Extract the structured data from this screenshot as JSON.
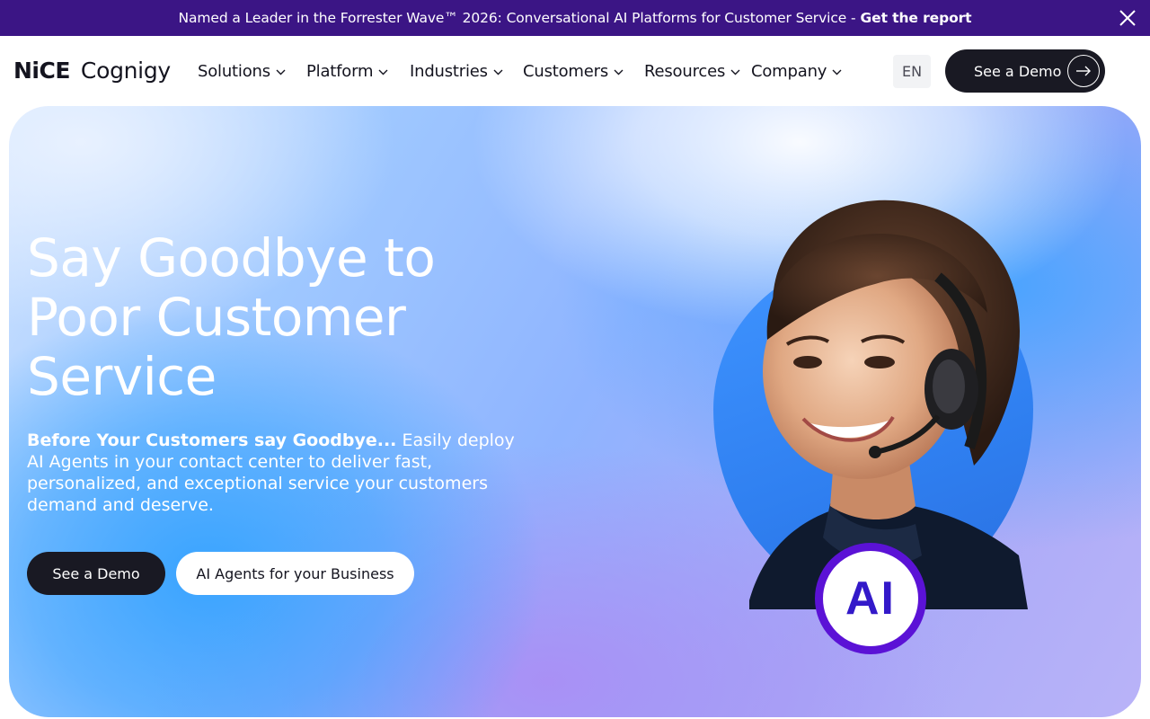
{
  "announcement": {
    "message": "Named a Leader in the Forrester Wave™ 2026: Conversational AI Platforms for Customer Service -",
    "cta": "Get the report",
    "close_icon": "close-icon"
  },
  "header": {
    "logo": {
      "brand": "NiCE",
      "product": "Cognigy"
    },
    "nav": [
      {
        "label": "Solutions"
      },
      {
        "label": "Platform"
      },
      {
        "label": "Industries"
      },
      {
        "label": "Customers"
      },
      {
        "label": "Resources"
      },
      {
        "label": "Company"
      }
    ],
    "language": "EN",
    "demo_button": "See a Demo",
    "demo_icon": "arrow-right-icon"
  },
  "hero": {
    "title": "Say Goodbye to Poor Customer Service",
    "subtitle_lead": "Before Your Customers say Goodbye...",
    "subtitle_rest": " Easily deploy AI Agents in your contact center to deliver fast, personalized, and exceptional service your customers demand and deserve.",
    "primary_button": "See a Demo",
    "secondary_button": "AI Agents for your Business",
    "badge": "AI"
  },
  "colors": {
    "announcement_bg": "#3b1585",
    "dark_button": "#191923",
    "badge_ring": "#5b12d6",
    "badge_text": "#3319c9"
  }
}
